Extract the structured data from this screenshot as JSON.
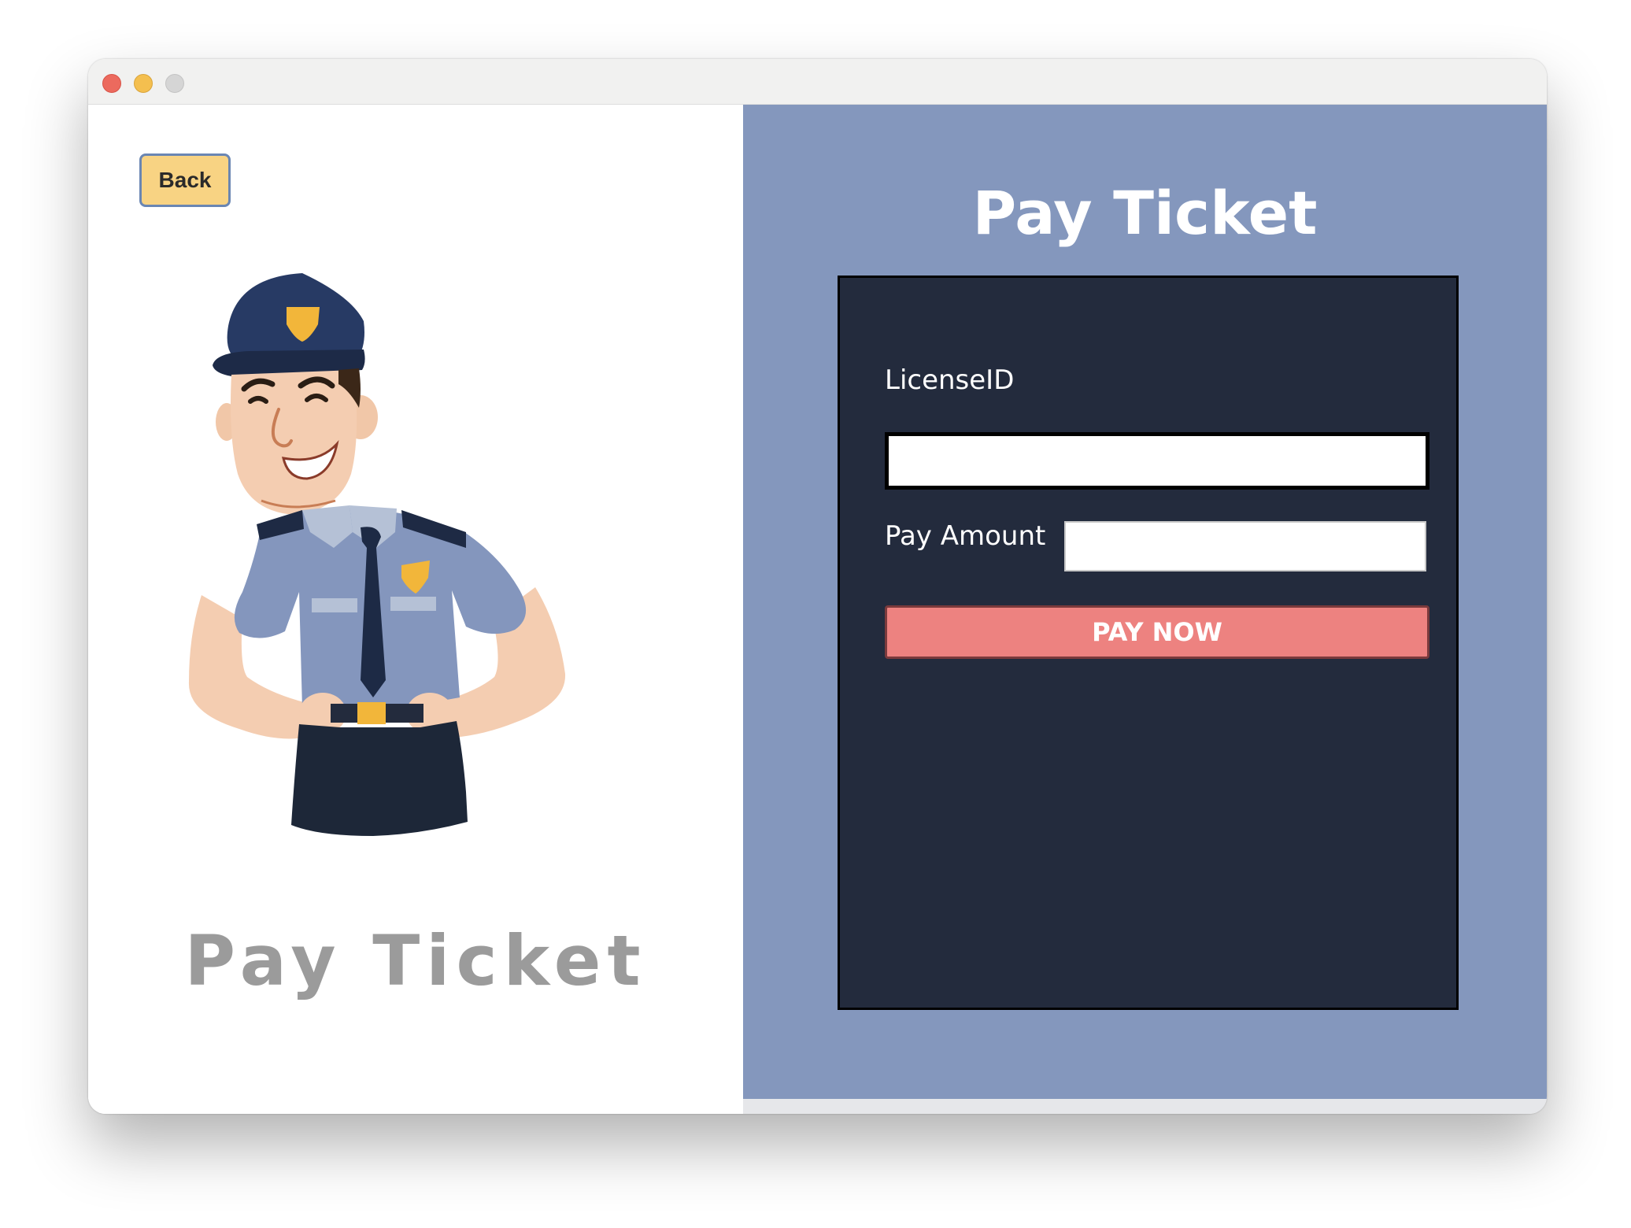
{
  "buttons": {
    "back_label": "Back",
    "pay_label": "PAY NOW"
  },
  "left": {
    "title": "Pay Ticket"
  },
  "right": {
    "title": "Pay Ticket"
  },
  "form": {
    "license_label": "LicenseID",
    "license_value": "",
    "amount_label": "Pay Amount",
    "amount_value": ""
  },
  "colors": {
    "right_panel": "#8497bd",
    "form_box": "#232b3d",
    "back_button": "#f8d383",
    "pay_button": "#ed8280",
    "left_title": "#9b9b9b"
  },
  "icons": {
    "illustration": "police-officer-illustration"
  }
}
